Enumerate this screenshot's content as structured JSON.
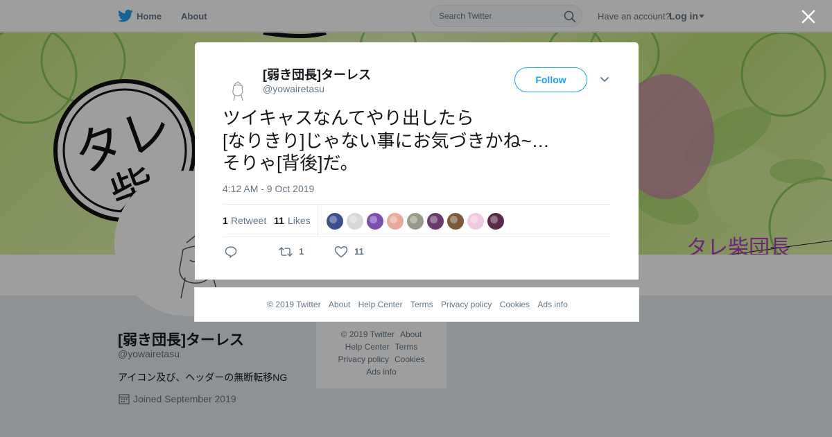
{
  "nav": {
    "home_label": "Home",
    "about_label": "About",
    "search_placeholder": "Search Twitter",
    "have_account": "Have an account?",
    "login_label": "Log in"
  },
  "profile": {
    "name": "[弱き団長]ターレス",
    "handle": "@yowairetasu",
    "bio": "アイコン及び、ヘッダーの無断転移NG",
    "joined": "Joined September 2019"
  },
  "side_footer": {
    "copyright": "© 2019 Twitter",
    "about": "About",
    "help": "Help Center",
    "terms": "Terms",
    "privacy": "Privacy policy",
    "cookies": "Cookies",
    "ads": "Ads info"
  },
  "tweet": {
    "author_name": "[弱き団長]ターレス",
    "author_handle": "@yowairetasu",
    "follow_label": "Follow",
    "text_lines": [
      "ツイキャスなんてやり出したら",
      "[なりきり]じゃない事にお気づきかね~…",
      "そりゃ[背後]だ。"
    ],
    "timestamp": "4:12 AM - 9 Oct 2019",
    "retweets_count": "1",
    "retweets_label": "Retweet",
    "likes_count": "11",
    "likes_label": "Likes",
    "action_retweet_count": "1",
    "action_like_count": "11",
    "liker_colors": [
      "#3a4f8c",
      "#d8d8d8",
      "#7b4fb0",
      "#e9a89a",
      "#9a9a8a",
      "#6a3a6a",
      "#7a5a3a",
      "#f0c8e0",
      "#5a2a4a"
    ]
  },
  "modal_footer": {
    "copyright": "© 2019 Twitter",
    "about": "About",
    "help": "Help Center",
    "terms": "Terms",
    "privacy": "Privacy policy",
    "cookies": "Cookies",
    "ads": "Ads info"
  },
  "colors": {
    "accent": "#1da1f2",
    "muted": "#657786"
  }
}
